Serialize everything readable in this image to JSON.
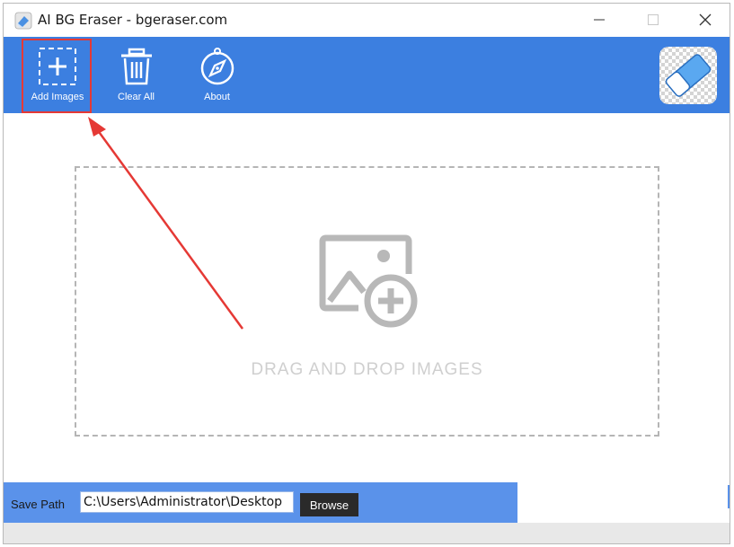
{
  "window": {
    "title": "AI BG Eraser - bgeraser.com",
    "controls": {
      "minimize": "—",
      "maximize": "☐",
      "close": "✕"
    }
  },
  "toolbar": {
    "buttons": [
      {
        "label": "Add Images",
        "icon": "add-image-icon"
      },
      {
        "label": "Clear All",
        "icon": "trash-icon"
      },
      {
        "label": "About",
        "icon": "compass-icon"
      }
    ],
    "logo_icon": "eraser-icon"
  },
  "dropzone": {
    "text": "DRAG AND DROP IMAGES",
    "icon": "image-add-icon"
  },
  "savebar": {
    "label": "Save Path",
    "path_value": "C:\\Users\\Administrator\\Desktop",
    "browse_label": "Browse"
  },
  "colors": {
    "toolbar_bg": "#3c7fe0",
    "savebar_bg": "#5a92ea",
    "highlight": "#e53935"
  }
}
